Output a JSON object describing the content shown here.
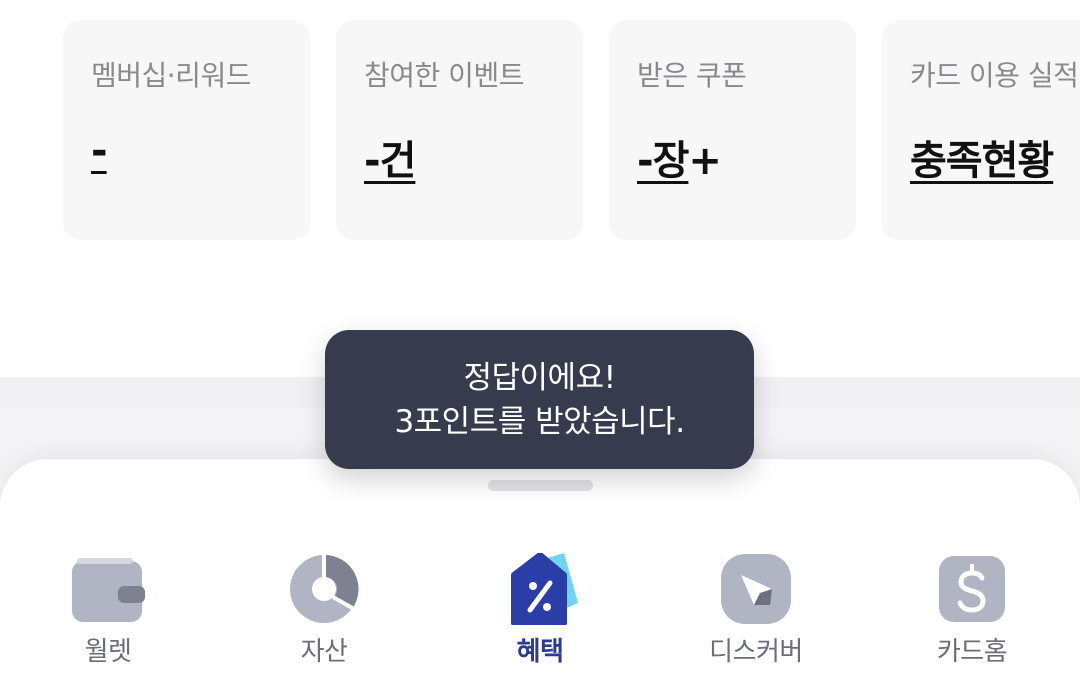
{
  "summary_cards": [
    {
      "label": "멤버십·리워드",
      "value": "-",
      "suffix": ""
    },
    {
      "label": "참여한 이벤트",
      "value": "-건",
      "suffix": ""
    },
    {
      "label": "받은 쿠폰",
      "value": "-장",
      "suffix": "+"
    },
    {
      "label": "카드 이용 실적",
      "value": "충족현황",
      "suffix": ""
    }
  ],
  "toast": {
    "line1": "정답이에요!",
    "line2": "3포인트를 받았습니다."
  },
  "bottom_nav": {
    "items": [
      {
        "label": "월렛",
        "icon": "wallet-icon",
        "active": false
      },
      {
        "label": "자산",
        "icon": "pie-chart-icon",
        "active": false
      },
      {
        "label": "혜택",
        "icon": "coupon-tag-icon",
        "active": true
      },
      {
        "label": "디스커버",
        "icon": "compass-icon",
        "active": false
      },
      {
        "label": "카드홈",
        "icon": "card-dollar-icon",
        "active": false
      }
    ]
  },
  "colors": {
    "active": "#2b3a93",
    "inactive": "#6b6e7a",
    "icon_gray": "#b1b4c2",
    "toast_bg": "#363b4d",
    "card_bg": "#f7f7f8"
  }
}
